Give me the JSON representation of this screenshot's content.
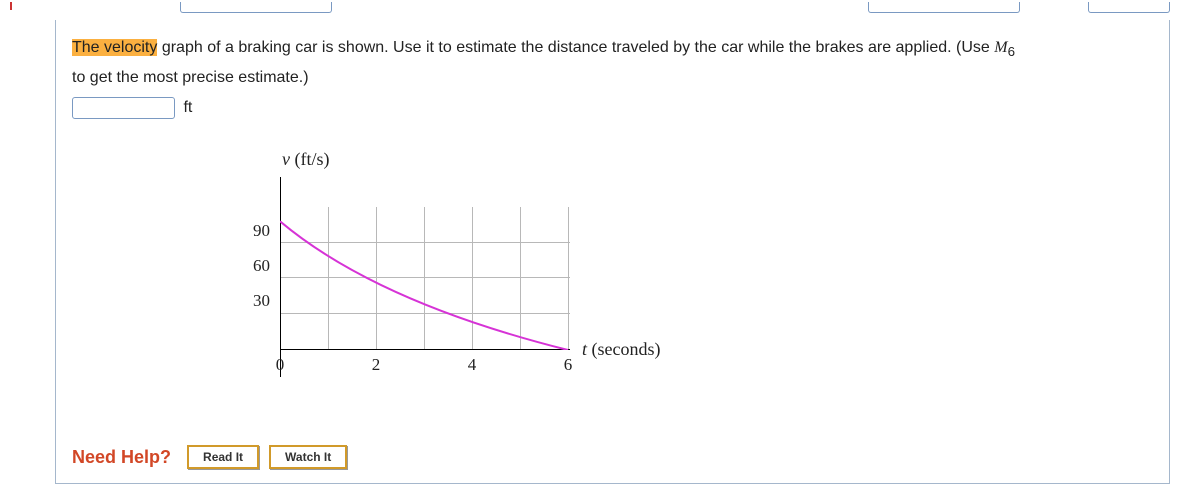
{
  "problem": {
    "highlighted_phrase": "The velocity",
    "text_rest": " graph of a braking car is shown. Use it to estimate the distance traveled by the car while the brakes are applied. (Use ",
    "method_var": "M",
    "method_sub": "6",
    "text_line2": "to get the most precise estimate.)",
    "unit": "ft"
  },
  "chart_data": {
    "type": "line",
    "title": "",
    "ylabel": "v (ft/s)",
    "xlabel": "t (seconds)",
    "x": [
      0,
      1,
      2,
      3,
      4,
      5,
      6
    ],
    "y": [
      108,
      72,
      50,
      33,
      20,
      10,
      0
    ],
    "xticks": [
      0,
      2,
      4,
      6
    ],
    "yticks": [
      30,
      60,
      90
    ],
    "xlim": [
      0,
      6
    ],
    "ylim": [
      0,
      120
    ],
    "color": "#d633d6"
  },
  "help": {
    "label": "Need Help?",
    "read": "Read It",
    "watch": "Watch It"
  }
}
